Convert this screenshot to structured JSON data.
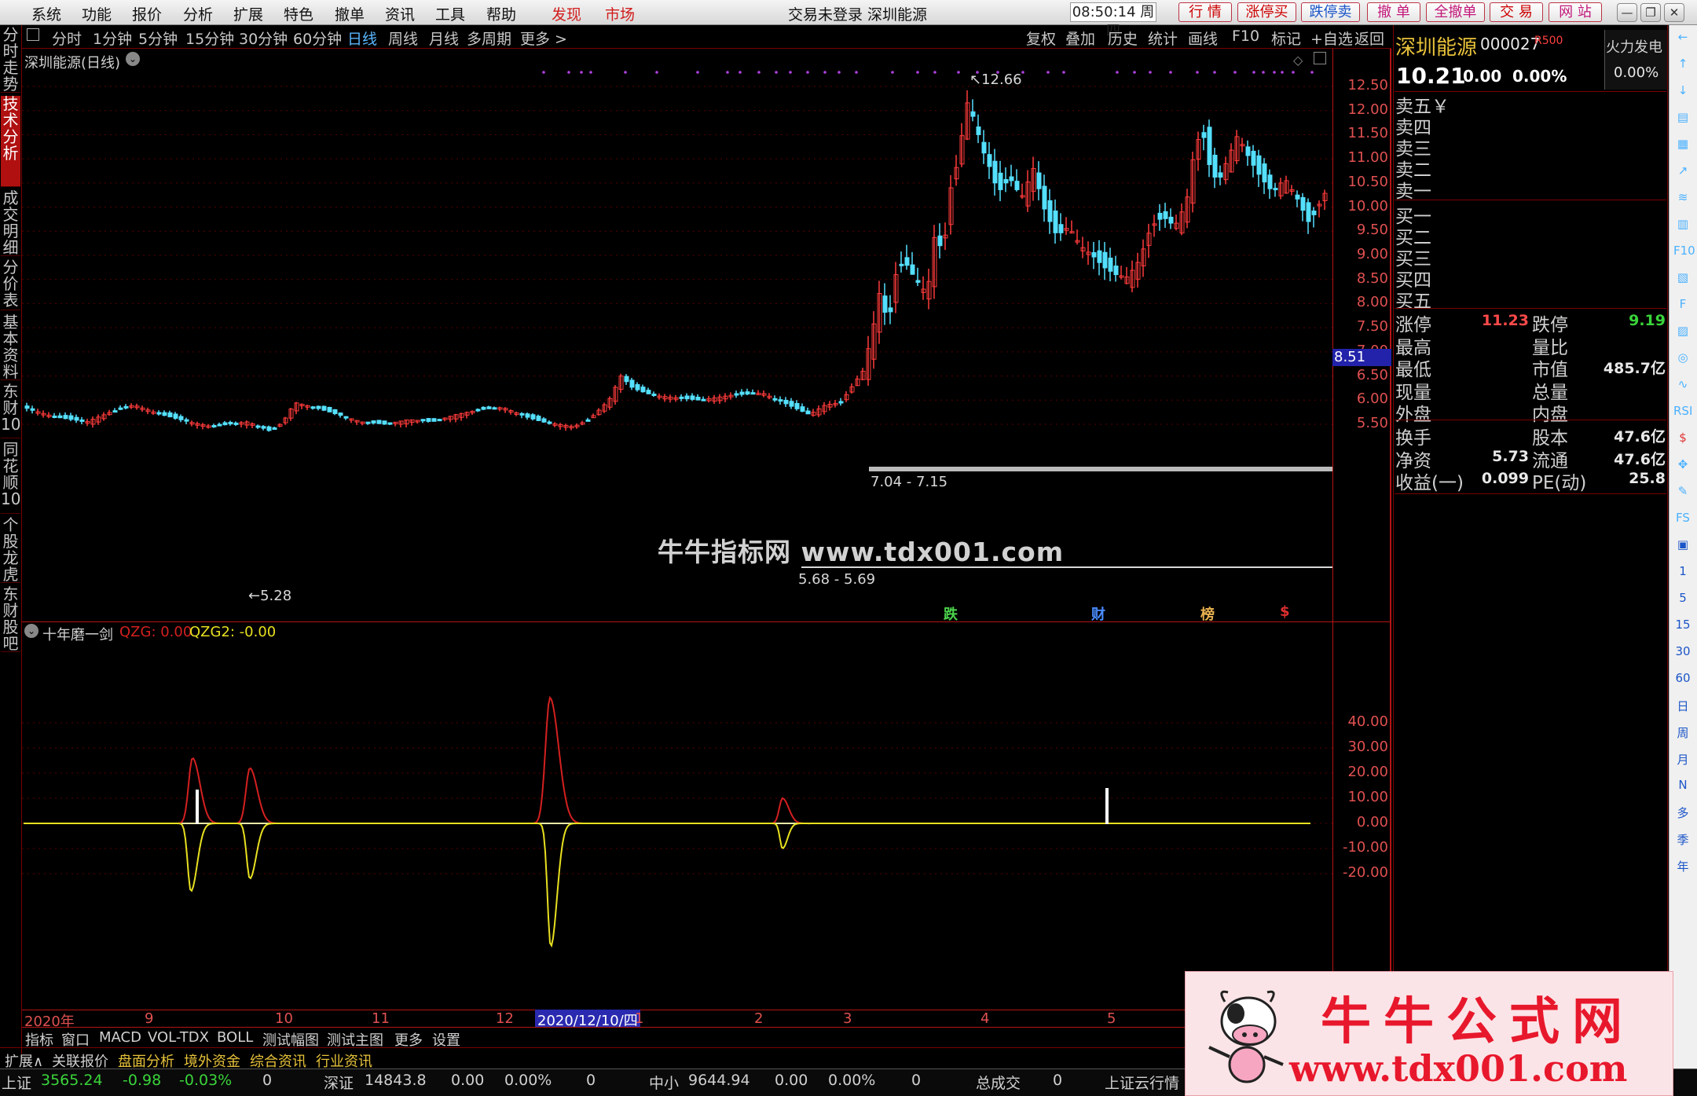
{
  "menu": {
    "items": [
      "系统",
      "功能",
      "报价",
      "分析",
      "扩展",
      "特色",
      "撤单",
      "资讯",
      "工具",
      "帮助"
    ],
    "discover": "发现",
    "market": "市场",
    "title": "交易未登录  深圳能源",
    "clock": "08:50:14 周四",
    "red_buttons": [
      "行 情",
      "涨停买",
      "跌停卖",
      "撤 单",
      "全撤单",
      "交 易",
      "网 站"
    ],
    "win_controls": [
      "—",
      "❐",
      "✕"
    ]
  },
  "left_tabs": [
    "分时走势",
    "技术分析",
    "成交明细",
    "分价表",
    "基本资料",
    "东财10",
    "同花顺10",
    "个股龙虎",
    "东财股吧"
  ],
  "left_active": 1,
  "periods": [
    "分时",
    "1分钟",
    "5分钟",
    "15分钟",
    "30分钟",
    "60分钟",
    "日线",
    "周线",
    "月线",
    "多周期",
    "更多 >"
  ],
  "period_selected": "日线",
  "tools": [
    "复权",
    "叠加",
    "历史",
    "统计",
    "画线",
    "F10",
    "标记",
    "+自选",
    "返回"
  ],
  "main_chart": {
    "title": "深圳能源(日线)",
    "high_label": "12.66",
    "low_label": "5.28",
    "gap_upper": "7.04 - 7.15",
    "gap_lower": "5.68 - 5.69",
    "current_price_tag": "8.51",
    "event_markers": [
      {
        "t": "跌",
        "c": "#4cd44c"
      },
      {
        "t": "财",
        "c": "#4a8cff"
      },
      {
        "t": "榜",
        "c": "#e8b050"
      },
      {
        "t": "$",
        "c": "#e03030"
      }
    ],
    "watermark": "牛牛指标网 www.tdx001.com",
    "y_ticks": [
      "12.50",
      "12.00",
      "11.50",
      "11.00",
      "10.50",
      "10.00",
      "9.50",
      "9.00",
      "8.50",
      "8.00",
      "7.50",
      "7.00",
      "6.50",
      "6.00",
      "5.50"
    ]
  },
  "sub_chart": {
    "title": "十年磨一剑",
    "qzg_label": "QZG: 0.00",
    "qzg2_label": "QZG2: -0.00",
    "y_ticks": [
      "40.00",
      "30.00",
      "20.00",
      "10.00",
      "0.00",
      "-10.00",
      "-20.00"
    ]
  },
  "x_axis": {
    "year": "2020年",
    "months": [
      "9",
      "10",
      "11",
      "12",
      "1",
      "2",
      "3",
      "4",
      "5"
    ],
    "cursor_date": "2020/12/10/四"
  },
  "bottom_tabs": [
    "指标",
    "窗口",
    "MACD",
    "VOL-TDX",
    "BOLL",
    "测试幅图",
    "测试主图",
    "更多",
    "设置"
  ],
  "bottom_tabs2": [
    {
      "t": "扩展∧",
      "c": "#d0d0d0"
    },
    {
      "t": "关联报价",
      "c": "#d0d0d0"
    },
    {
      "t": "盘面分析",
      "c": "#e6c23a"
    },
    {
      "t": "境外资金",
      "c": "#e6c23a"
    },
    {
      "t": "综合资讯",
      "c": "#e6c23a"
    },
    {
      "t": "行业资讯",
      "c": "#e6c23a"
    }
  ],
  "status": {
    "sh_label": "上证",
    "sh_val": "3565.24",
    "sh_chg": "-0.98",
    "sh_pct": "-0.03%",
    "sh_vol": "0",
    "sz_label": "深证",
    "sz_val": "14843.8",
    "sz_chg": "0.00",
    "sz_pct": "0.00%",
    "sz_vol": "0",
    "zx_label": "中小",
    "zx_val": "9644.94",
    "zx_chg": "0.00",
    "zx_pct": "0.00%",
    "zx_vol": "0",
    "total_label": "总成交",
    "total_val": "0",
    "cloud": "上证云行情"
  },
  "quote": {
    "name": "深圳能源",
    "code": "000027",
    "badge": "R500",
    "sector": "火力发电",
    "sector_pct": "0.00%",
    "price": "10.21",
    "change": "0.00",
    "pct": "0.00%",
    "sell_labels": [
      "卖五￥",
      "卖四",
      "卖三",
      "卖二",
      "卖一"
    ],
    "buy_labels": [
      "买一",
      "买二",
      "买三",
      "买四",
      "买五"
    ],
    "stats": [
      {
        "l1": "涨停",
        "v1": "11.23",
        "c1": "#ff4a4a",
        "l2": "跌停",
        "v2": "9.19",
        "c2": "#3ad43a"
      },
      {
        "l1": "最高",
        "v1": "",
        "c1": "#fff",
        "l2": "量比",
        "v2": "",
        "c2": "#fff"
      },
      {
        "l1": "最低",
        "v1": "",
        "c1": "#fff",
        "l2": "市值",
        "v2": "485.7亿",
        "c2": "#e8e8e8"
      },
      {
        "l1": "现量",
        "v1": "",
        "c1": "#fff",
        "l2": "总量",
        "v2": "",
        "c2": "#fff"
      },
      {
        "l1": "外盘",
        "v1": "",
        "c1": "#fff",
        "l2": "内盘",
        "v2": "",
        "c2": "#fff"
      }
    ],
    "stats2": [
      {
        "l1": "换手",
        "v1": "",
        "l2": "股本",
        "v2": "47.6亿"
      },
      {
        "l1": "净资",
        "v1": "5.73",
        "l2": "流通",
        "v2": "47.6亿"
      },
      {
        "l1": "收益(一)",
        "v1": "0.099",
        "l2": "PE(动)",
        "v2": "25.8"
      }
    ]
  },
  "right_icons": [
    "←",
    "↑",
    "↓",
    "▤",
    "▦",
    "↗",
    "≋",
    "▥",
    "F10",
    "▧",
    "F",
    "▨",
    "◎",
    "∿",
    "RSI",
    "$",
    "✥",
    "✎",
    "FS",
    "▣",
    "1",
    "5",
    "15",
    "30",
    "60",
    "日",
    "周",
    "月",
    "N",
    "多",
    "季",
    "年"
  ],
  "banner": {
    "title": "牛牛公式网",
    "url": "www.tdx001.com"
  },
  "colors": {
    "up": "#ff3b3b",
    "down": "#54e0ff",
    "qzg": "#d42020",
    "qzg2": "#e8e020",
    "axis": "#b41414"
  }
}
